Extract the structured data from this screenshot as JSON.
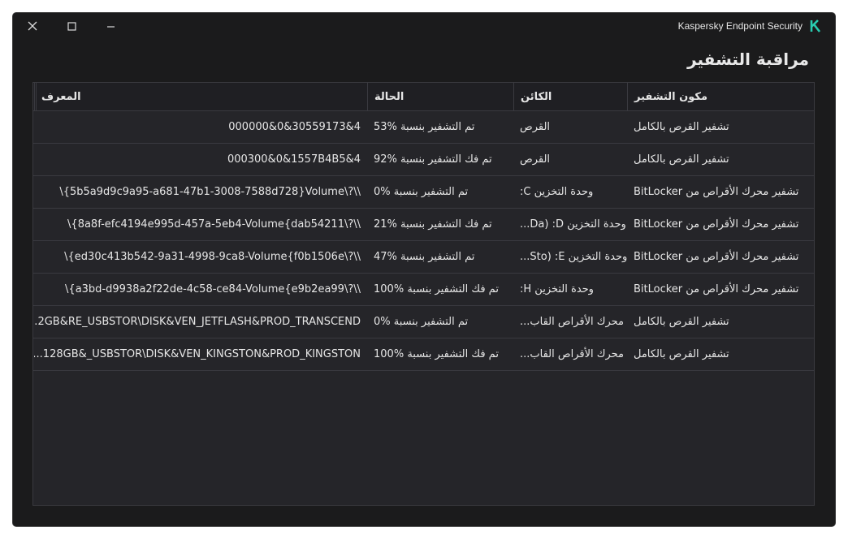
{
  "window": {
    "app_title": "Kaspersky Endpoint Security",
    "logo_color": "#29ccb1",
    "logo_text": "K"
  },
  "page": {
    "title": "مراقبة التشفير"
  },
  "table": {
    "columns": [
      "مكون التشفير",
      "الكائن",
      "الحالة",
      "المعرف"
    ],
    "rows": [
      {
        "component": "تشفير القرص بالكامل",
        "object": "القرص",
        "status": "تم التشفير بنسبة %53",
        "id": "000000&0&30559173&4"
      },
      {
        "component": "تشفير القرص بالكامل",
        "object": "القرص",
        "status": "تم فك التشفير بنسبة %92",
        "id": "000300&0&1557B4B5&4"
      },
      {
        "component": "تشفير محرك الأقراص من BitLocker",
        "object": "وحدة التخزين C:",
        "status": "تم التشفير بنسبة %0",
        "id": "\\{5b5a9d9c9a95-a681-47b1-3008-7588d728}Volume\\?\\\\"
      },
      {
        "component": "تشفير محرك الأقراص من BitLocker",
        "object": "وحدة التخزين Da) :D...",
        "status": "تم فك التشفير بنسبة %21",
        "id": "\\{8a8f-efc4194e995d-457a-5eb4-Volume{dab54211\\?\\\\"
      },
      {
        "component": "تشفير محرك الأقراص من BitLocker",
        "object": "وحدة التخزين Sto) :E...",
        "status": "تم التشفير بنسبة %47",
        "id": "\\{ed30c413b542-9a31-4998-9ca8-Volume{f0b1506e\\?\\\\"
      },
      {
        "component": "تشفير محرك الأقراص من BitLocker",
        "object": "وحدة التخزين H:",
        "status": "تم فك التشفير بنسبة %100",
        "id": "\\{a3bd-d9938a2f22de-4c58-ce84-Volume{e9b2ea99\\?\\\\"
      },
      {
        "component": "تشفير القرص بالكامل",
        "object": "محرك الأقراص القاب...",
        "status": "تم التشفير بنسبة %0",
        "id": "...2GB&RE_USBSTOR\\DISK&VEN_JETFLASH&PROD_TRANSCEND"
      },
      {
        "component": "تشفير القرص بالكامل",
        "object": "محرك الأقراص القاب...",
        "status": "تم فك التشفير بنسبة %100",
        "id": "...128GB&_USBSTOR\\DISK&VEN_KINGSTON&PROD_KINGSTON"
      }
    ]
  }
}
